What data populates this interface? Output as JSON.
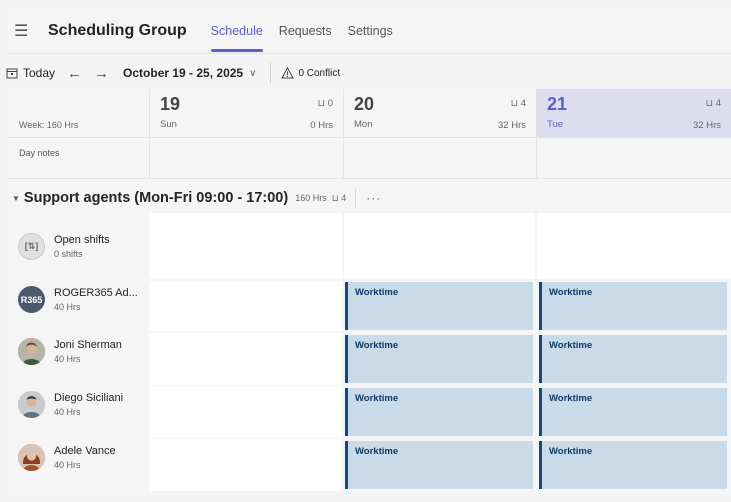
{
  "header": {
    "app_title": "Scheduling Group",
    "tabs": [
      {
        "label": "Schedule",
        "active": true
      },
      {
        "label": "Requests",
        "active": false
      },
      {
        "label": "Settings",
        "active": false
      }
    ]
  },
  "toolbar": {
    "today_label": "Today",
    "date_range": "October 19 - 25, 2025",
    "conflict_label": "0 Conflict"
  },
  "week": {
    "hours_label": "Week: 160 Hrs",
    "day_notes_label": "Day notes",
    "days": [
      {
        "num": "19",
        "name": "Sun",
        "staff": "0",
        "hours": "0 Hrs",
        "selected": false
      },
      {
        "num": "20",
        "name": "Mon",
        "staff": "4",
        "hours": "32 Hrs",
        "selected": false
      },
      {
        "num": "21",
        "name": "Tue",
        "staff": "4",
        "hours": "32 Hrs",
        "selected": true
      }
    ]
  },
  "group": {
    "title": "Support agents (Mon-Fri 09:00 - 17:00)",
    "hours": "160 Hrs",
    "staff": "4"
  },
  "open_shifts": {
    "name": "Open shifts",
    "count": "0 shifts"
  },
  "members": [
    {
      "name": "ROGER365 Ad...",
      "hours": "40 Hrs",
      "initials": "R365",
      "avatar_color": "#4a5a6a"
    },
    {
      "name": "Joni Sherman",
      "hours": "40 Hrs",
      "initials": "",
      "avatar_color": "#7a6a58"
    },
    {
      "name": "Diego Siciliani",
      "hours": "40 Hrs",
      "initials": "",
      "avatar_color": "#6d7f8c"
    },
    {
      "name": "Adele Vance",
      "hours": "40 Hrs",
      "initials": "",
      "avatar_color": "#8a5a44"
    }
  ],
  "shift_label": "Worktime",
  "colors": {
    "accent": "#5b5fc7",
    "shift_fill": "#c9dbe8",
    "shift_border": "#0f4a86"
  }
}
